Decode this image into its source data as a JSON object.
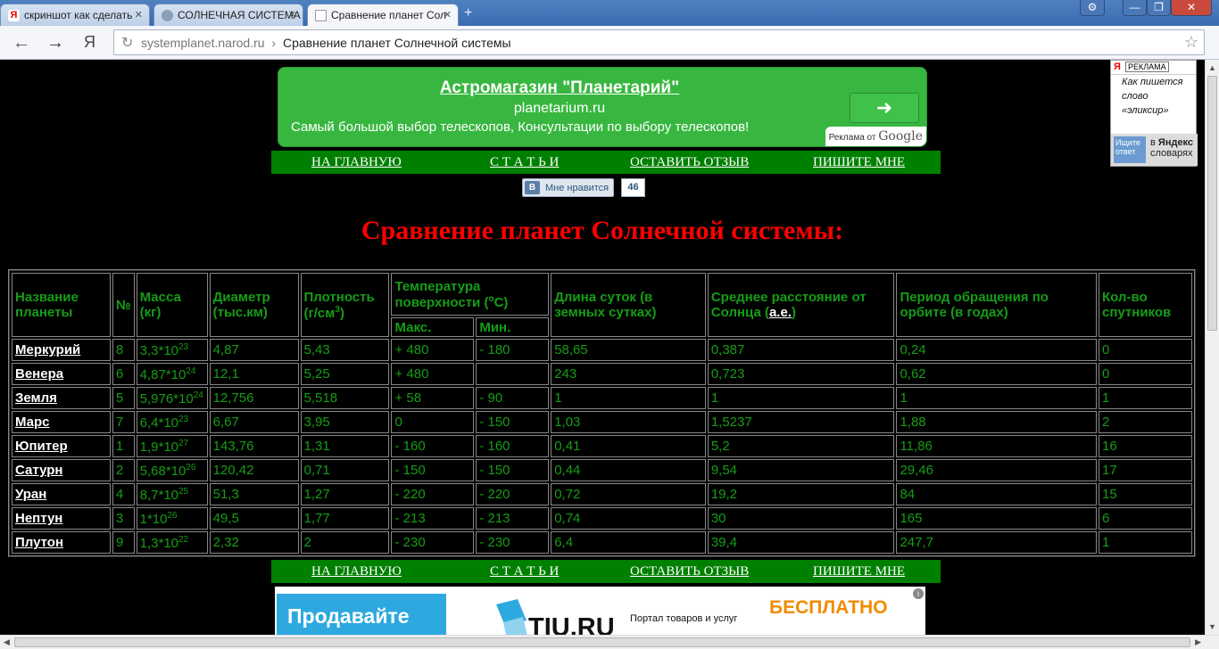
{
  "browser": {
    "tabs": [
      {
        "label": "скриншот как сделать",
        "active": false
      },
      {
        "label": "СОЛНЕЧНАЯ СИСТЕМА",
        "active": false
      },
      {
        "label": "Сравнение планет Сол",
        "active": true
      }
    ],
    "new_tab_symbol": "+",
    "url_host": "systemplanet.narod.ru",
    "url_separator": "›",
    "url_title": "Сравнение планет Солнечной системы",
    "yandex_button": "Я"
  },
  "ad_top": {
    "title": "Астромагазин \"Планетарий\"",
    "url": "planetarium.ru",
    "description": "Самый большой выбор телескопов, Консультации по выбору телескопов!",
    "badge_text": "Реклама от",
    "badge_brand": "Google",
    "accent": "#38b740"
  },
  "nav": {
    "home": "НА ГЛАВНУЮ",
    "articles": "С Т А Т Ь И",
    "feedback": "ОСТАВИТЬ ОТЗЫВ",
    "write": "ПИШИТЕ МНЕ"
  },
  "like": {
    "vk_letter": "В",
    "label": "Мне нравится",
    "count": "46"
  },
  "page_title": "Сравнение планет Солнечной системы:",
  "table": {
    "headers": {
      "name": "Название планеты",
      "num": "№",
      "mass": "Масса (кг)",
      "diameter": "Диаметр (тыс.км)",
      "density": "Плотность (г/см",
      "density_sup": "3",
      "density_tail": ")",
      "temp": "Температура поверхности (",
      "temp_sup": "o",
      "temp_tail": "С)",
      "temp_max": "Макс.",
      "temp_min": "Мин.",
      "day": "Длина суток (в земных сутках)",
      "distance": "Среднее расстояние от Солнца (",
      "distance_link": "а.е.",
      "distance_tail": ")",
      "period": "Период обращения по орбите (в годах)",
      "moons": "Кол-во спутников"
    },
    "rows": [
      {
        "name": "Меркурий",
        "num": "8",
        "mass": "3,3*10",
        "mass_exp": "23",
        "diameter": "4,87",
        "density": "5,43",
        "tmax": "+ 480",
        "tmin": "- 180",
        "day": "58,65",
        "distance": "0,387",
        "period": "0,24",
        "moons": "0"
      },
      {
        "name": "Венера",
        "num": "6",
        "mass": "4,87*10",
        "mass_exp": "24",
        "diameter": "12,1",
        "density": "5,25",
        "tmax": "+ 480",
        "tmin": "",
        "day": "243",
        "distance": "0,723",
        "period": "0,62",
        "moons": "0"
      },
      {
        "name": "Земля",
        "num": "5",
        "mass": "5,976*10",
        "mass_exp": "24",
        "diameter": "12,756",
        "density": "5,518",
        "tmax": "+ 58",
        "tmin": "- 90",
        "day": "1",
        "distance": "1",
        "period": "1",
        "moons": "1"
      },
      {
        "name": "Марс",
        "num": "7",
        "mass": "6,4*10",
        "mass_exp": "23",
        "diameter": "6,67",
        "density": "3,95",
        "tmax": "0",
        "tmin": "- 150",
        "day": "1,03",
        "distance": "1,5237",
        "period": "1,88",
        "moons": "2"
      },
      {
        "name": "Юпитер",
        "num": "1",
        "mass": "1,9*10",
        "mass_exp": "27",
        "diameter": "143,76",
        "density": "1,31",
        "tmax": "- 160",
        "tmin": "- 160",
        "day": "0,41",
        "distance": "5,2",
        "period": "11,86",
        "moons": "16"
      },
      {
        "name": "Сатурн",
        "num": "2",
        "mass": "5,68*10",
        "mass_exp": "26",
        "diameter": "120,42",
        "density": "0,71",
        "tmax": "- 150",
        "tmin": "- 150",
        "day": "0,44",
        "distance": "9,54",
        "period": "29,46",
        "moons": "17"
      },
      {
        "name": "Уран",
        "num": "4",
        "mass": "8,7*10",
        "mass_exp": "25",
        "diameter": "51,3",
        "density": "1,27",
        "tmax": "- 220",
        "tmin": "- 220",
        "day": "0,72",
        "distance": "19,2",
        "period": "84",
        "moons": "15"
      },
      {
        "name": "Нептун",
        "num": "3",
        "mass": "1*10",
        "mass_exp": "26",
        "diameter": "49,5",
        "density": "1,77",
        "tmax": "- 213",
        "tmin": "- 213",
        "day": "0,74",
        "distance": "30",
        "period": "165",
        "moons": "6"
      },
      {
        "name": "Плутон",
        "num": "9",
        "mass": "1,3*10",
        "mass_exp": "22",
        "diameter": "2,32",
        "density": "2",
        "tmax": "- 230",
        "tmin": "- 230",
        "day": "6,4",
        "distance": "39,4",
        "period": "247,7",
        "moons": "1"
      }
    ]
  },
  "yandex_widget": {
    "logo": "Я",
    "ad_label": "РЕКЛАМА",
    "words": [
      "Как пишется",
      "слово",
      "«эликсир»"
    ],
    "search": "Ищите ответ",
    "brand_in": "в",
    "brand": "Яндекс",
    "brand_sub": "словарях"
  },
  "ad_bottom": {
    "sell": "Продавайте",
    "logo": "TIU.RU",
    "tagline": "Портал товаров и услуг",
    "free": "БЕСПЛАТНО",
    "info": "i"
  },
  "colors": {
    "page_bg": "#000000",
    "table_text": "#169d16",
    "nav_bg": "#008000",
    "title_red": "#ff0000"
  }
}
